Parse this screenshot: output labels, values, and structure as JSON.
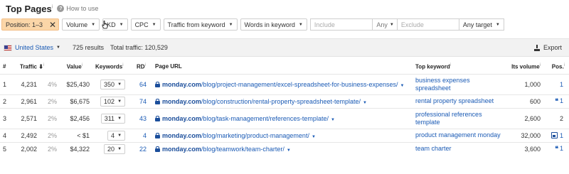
{
  "header": {
    "title": "Top Pages",
    "title_info": "i",
    "how_to_use": "How to use"
  },
  "filters": {
    "position": "Position: 1–3",
    "volume": "Volume",
    "kd": "KD",
    "cpc": "CPC",
    "traffic_from_keyword": "Traffic from keyword",
    "words_in_keyword": "Words in keyword",
    "include_placeholder": "Include",
    "any": "Any",
    "exclude_placeholder": "Exclude",
    "any_target": "Any target"
  },
  "summary": {
    "country": "United States",
    "results": "725 results",
    "total_traffic": "Total traffic: 120,529",
    "export": "Export"
  },
  "columns": {
    "num": "#",
    "traffic": "Traffic",
    "value": "Value",
    "keywords": "Keywords",
    "rd": "RD",
    "page_url": "Page URL",
    "top_keyword": "Top keyword",
    "its_volume": "Its volume",
    "pos": "Pos."
  },
  "rows": [
    {
      "num": "1",
      "traffic": "4,231",
      "pct": "4%",
      "value": "$25,430",
      "keywords": "350",
      "rd": "64",
      "domain": "monday.com",
      "path": "/blog/project-management/excel-spreadsheet-for-business-expenses/",
      "top_keyword": "business expenses spreadsheet",
      "volume": "1,000",
      "pos": "1",
      "pos_icon": "none"
    },
    {
      "num": "2",
      "traffic": "2,961",
      "pct": "2%",
      "value": "$6,675",
      "keywords": "102",
      "rd": "74",
      "domain": "monday.com",
      "path": "/blog/construction/rental-property-spreadsheet-template/",
      "top_keyword": "rental property spreadsheet",
      "volume": "600",
      "pos": "1",
      "pos_icon": "quote-icon"
    },
    {
      "num": "3",
      "traffic": "2,571",
      "pct": "2%",
      "value": "$2,456",
      "keywords": "311",
      "rd": "43",
      "domain": "monday.com",
      "path": "/blog/task-management/references-template/",
      "top_keyword": "professional references template",
      "volume": "2,600",
      "pos": "2",
      "pos_icon": "none"
    },
    {
      "num": "4",
      "traffic": "2,492",
      "pct": "2%",
      "value": "< $1",
      "keywords": "4",
      "rd": "4",
      "domain": "monday.com",
      "path": "/blog/marketing/product-management/",
      "top_keyword": "product management monday",
      "volume": "32,000",
      "pos": "1",
      "pos_icon": "image-icon"
    },
    {
      "num": "5",
      "traffic": "2,002",
      "pct": "2%",
      "value": "$4,322",
      "keywords": "20",
      "rd": "22",
      "domain": "monday.com",
      "path": "/blog/teamwork/team-charter/",
      "top_keyword": "team charter",
      "volume": "3,600",
      "pos": "1",
      "pos_icon": "quote-icon"
    }
  ]
}
